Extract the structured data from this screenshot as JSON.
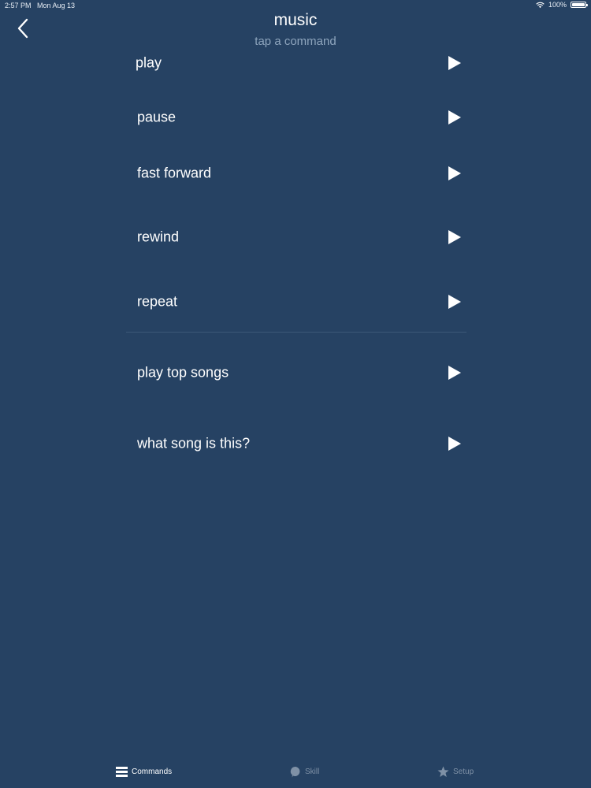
{
  "status_bar": {
    "time": "2:57 PM",
    "date": "Mon Aug 13",
    "battery": "100%"
  },
  "header": {
    "back_icon": "chevron-left-icon",
    "title": "music",
    "subtitle": "tap a command"
  },
  "commands": [
    {
      "label": "play",
      "icon": "play-icon"
    },
    {
      "label": "pause",
      "icon": "play-icon"
    },
    {
      "label": "fast forward",
      "icon": "play-icon"
    },
    {
      "label": "rewind",
      "icon": "play-icon"
    },
    {
      "label": "repeat",
      "icon": "play-icon"
    },
    {
      "label": "play top songs",
      "icon": "play-icon"
    },
    {
      "label": "what song is this?",
      "icon": "play-icon"
    }
  ],
  "tab_bar": {
    "tabs": [
      {
        "label": "Commands",
        "icon": "list-icon",
        "active": true
      },
      {
        "label": "Skill",
        "icon": "speech-bubble-icon",
        "active": false
      },
      {
        "label": "Setup",
        "icon": "star-icon",
        "active": false
      }
    ]
  },
  "colors": {
    "background": "#264263",
    "subtitle": "#8ea5bd",
    "inactive_tab": "#7f91a6",
    "divider": "#3c5878"
  }
}
